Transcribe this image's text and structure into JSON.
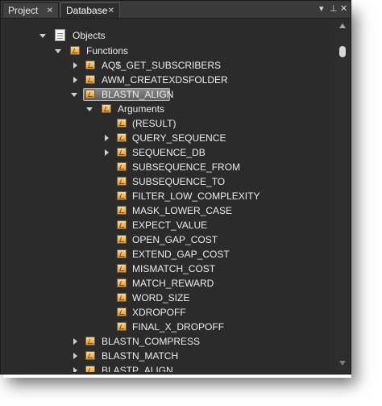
{
  "tabs": [
    {
      "label": "Project",
      "close": "✕"
    },
    {
      "label": "Database",
      "close": "✕"
    }
  ],
  "panel_controls": {
    "menu": "▾",
    "pin": "⊥",
    "close": "✕"
  },
  "tree": {
    "root": "Objects",
    "functions": "Functions",
    "items_before": [
      "AQ$_GET_SUBSCRIBERS",
      "AWM_CREATEXDSFOLDER"
    ],
    "selected": "BLASTN_ALIGN",
    "arguments_label": "Arguments",
    "arguments": [
      "(RESULT)",
      "QUERY_SEQUENCE",
      "SEQUENCE_DB",
      "SUBSEQUENCE_FROM",
      "SUBSEQUENCE_TO",
      "FILTER_LOW_COMPLEXITY",
      "MASK_LOWER_CASE",
      "EXPECT_VALUE",
      "OPEN_GAP_COST",
      "EXTEND_GAP_COST",
      "MISMATCH_COST",
      "MATCH_REWARD",
      "WORD_SIZE",
      "XDROPOFF",
      "FINAL_X_DROPOFF"
    ],
    "items_after": [
      "BLASTN_COMPRESS",
      "BLASTN_MATCH",
      "BLASTP_ALIGN"
    ]
  },
  "colors": {
    "panel_bg": "#2b2b2b",
    "text": "#ececec",
    "folder": "#d79a42"
  }
}
